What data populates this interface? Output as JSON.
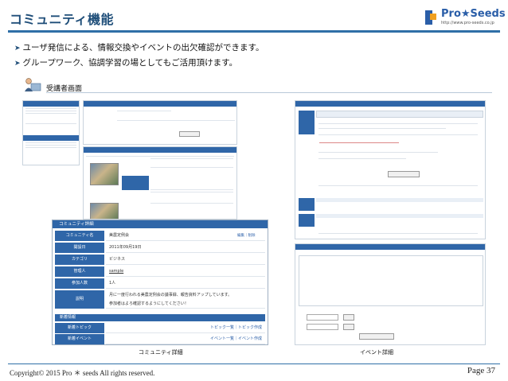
{
  "slide": {
    "title": "コミュニティ機能",
    "bullets": [
      "ユーザ発信による、情報交換やイベントの出欠確認ができます。",
      "グループワーク、協調学習の場としてもご活用頂けます。"
    ],
    "section_label": "受講者画面",
    "captions": [
      "コミュニティ詳細",
      "イベント詳細"
    ],
    "copyright": "Copyright© 2015 Pro ＊ seeds All rights reserved.",
    "page": "Page 37"
  },
  "logo": {
    "text": "Pro★Seeds",
    "url": "http://www.pro-seeds.co.jp"
  },
  "community_detail": {
    "title": "コミュニティ詳細",
    "edit_links": "編集｜削除",
    "rows": [
      {
        "key": "コミュニティ名",
        "value": "美農定例会"
      },
      {
        "key": "開設日",
        "value": "2011年09月19日"
      },
      {
        "key": "カテゴリ",
        "value": "ビジネス"
      },
      {
        "key": "管理人",
        "value": "sample"
      },
      {
        "key": "参加人数",
        "value": "1人"
      },
      {
        "key": "説明",
        "value": "月に一度行われる美農定例会の議事録、報告資料アップしています。"
      },
      {
        "key": "",
        "value": "参加者はよろ確認するようにしてください！"
      }
    ],
    "news_title": "新着情報",
    "news_rows": [
      {
        "key": "新着トピック",
        "links": "トピック一覧｜トピック作成"
      },
      {
        "key": "新着イベント",
        "links": "イベント一覧｜イベント作成"
      }
    ]
  },
  "colors": {
    "accent": "#2f66a8",
    "title": "#1f4e79"
  }
}
